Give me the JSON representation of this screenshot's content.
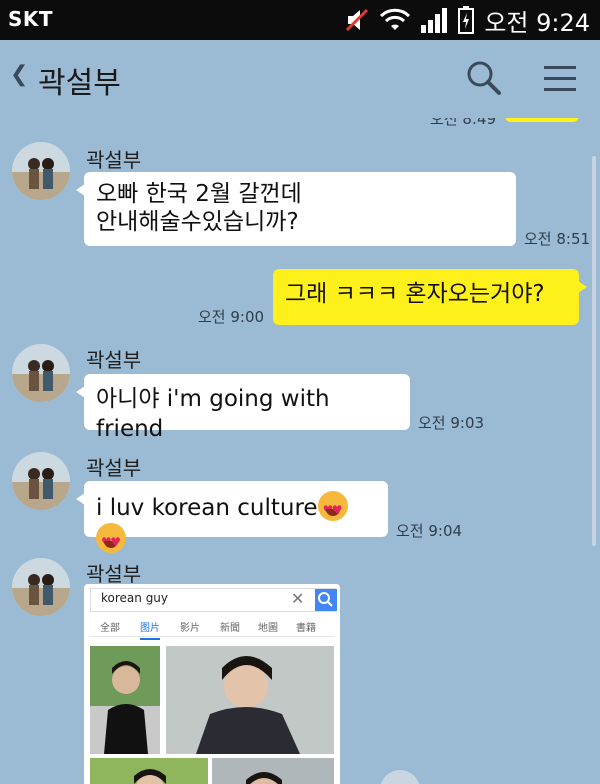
{
  "status_bar": {
    "carrier": "SKT",
    "time": "오전 9:24"
  },
  "header": {
    "title": "곽설부"
  },
  "messages": [
    {
      "time": "오전 8:49"
    },
    {
      "sender": "곽설부",
      "text_line1": "오빠 한국 2월 갈껀데",
      "text_line2": "안내해술수있습니까?",
      "time": "오전 8:51"
    },
    {
      "text": "그래 ㅋㅋㅋ 혼자오는거야?",
      "time": "오전 9:00"
    },
    {
      "sender": "곽설부",
      "text": "아니야 i'm going with friend",
      "time": "오전 9:03"
    },
    {
      "sender": "곽설부",
      "text": "i luv korean culture",
      "emoji": "smiling-face-with-heart-eyes",
      "time": "오전 9:04"
    },
    {
      "sender": "곽설부",
      "image": {
        "query": "korean guy",
        "tabs": [
          "全部",
          "图片",
          "影片",
          "新聞",
          "地圖",
          "書籍"
        ],
        "active_tab": "图片"
      }
    }
  ],
  "colors": {
    "chat_bg": "#9bbbd4",
    "my_bubble": "#fef01b",
    "their_bubble": "#ffffff"
  }
}
